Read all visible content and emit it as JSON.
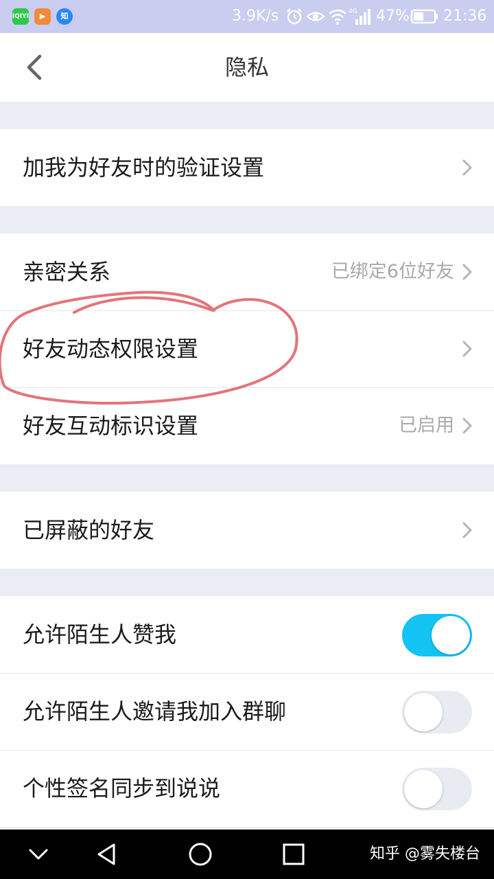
{
  "status_bar": {
    "apps": [
      {
        "icon": "iqiyi-icon",
        "label": "iQIYI",
        "color": "#2ec94b"
      },
      {
        "icon": "video-play-icon",
        "label": "▶",
        "color": "#f28a3c"
      },
      {
        "icon": "zhihu-icon",
        "label": "知",
        "color": "#2a86f5"
      }
    ],
    "speed": "3.9K/s",
    "network": "4G",
    "battery": "47%",
    "time": "21:36"
  },
  "header": {
    "title": "隐私"
  },
  "groups": [
    {
      "rows": [
        {
          "label": "加我为好友时的验证设置",
          "value": "",
          "control": "chevron"
        }
      ]
    },
    {
      "rows": [
        {
          "label": "亲密关系",
          "value": "已绑定6位好友",
          "control": "chevron"
        },
        {
          "label": "好友动态权限设置",
          "value": "",
          "control": "chevron"
        },
        {
          "label": "好友互动标识设置",
          "value": "已启用",
          "control": "chevron"
        }
      ]
    },
    {
      "rows": [
        {
          "label": "已屏蔽的好友",
          "value": "",
          "control": "chevron"
        }
      ]
    },
    {
      "rows": [
        {
          "label": "允许陌生人赞我",
          "control": "toggle",
          "enabled": true
        },
        {
          "label": "允许陌生人邀请我加入群聊",
          "control": "toggle",
          "enabled": false
        },
        {
          "label": "个性签名同步到说说",
          "control": "toggle",
          "enabled": false
        }
      ]
    }
  ],
  "annotation": {
    "color": "#e3747a",
    "circles_row": "好友动态权限设置"
  },
  "toggle_colors": {
    "on": "#12c3f3",
    "off": "#e9ebf3"
  },
  "nav_bar": {
    "buttons": [
      "collapse-icon",
      "back-triangle-icon",
      "home-circle-icon",
      "recents-square-icon"
    ],
    "watermark": "知乎 @雾失楼台"
  }
}
